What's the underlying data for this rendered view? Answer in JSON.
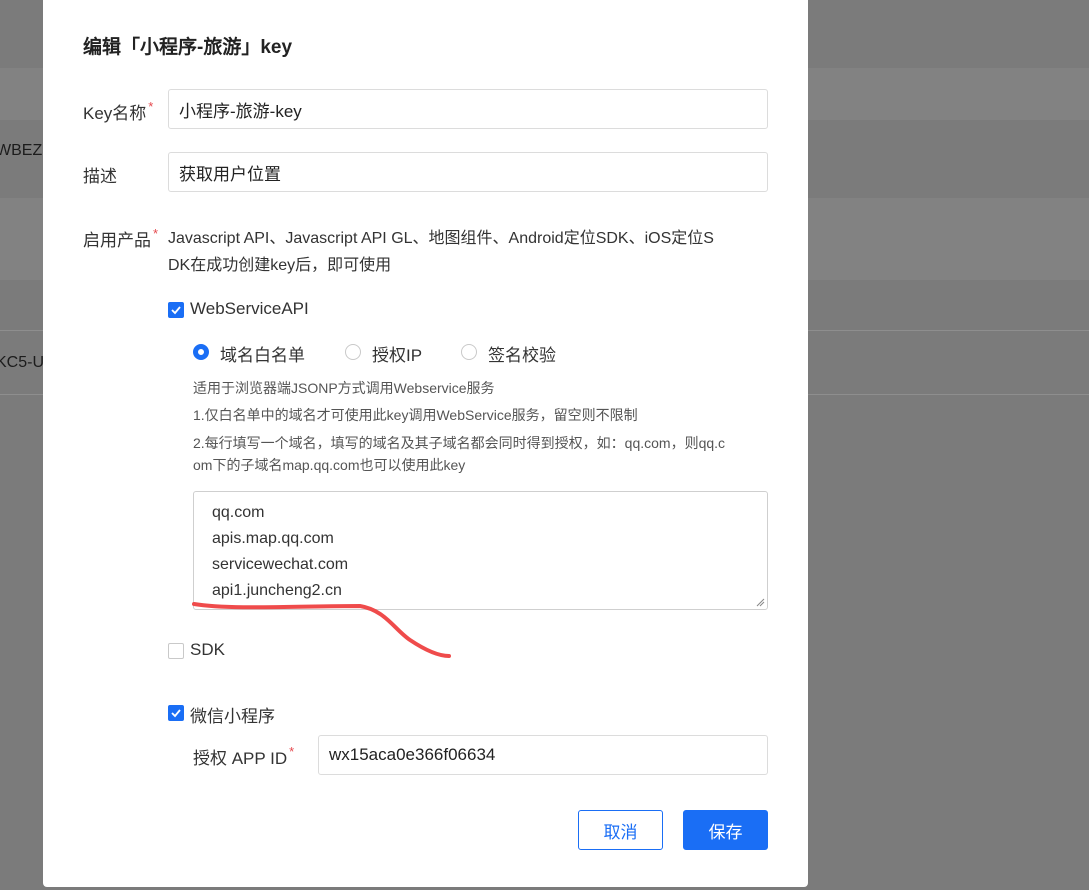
{
  "background": {
    "fragments": [
      "WBEZ",
      "KC5-U"
    ]
  },
  "dialog": {
    "title": "编辑「小程序-旅游」key",
    "key_name": {
      "label": "Key名称",
      "required": "*",
      "value": "小程序-旅游-key"
    },
    "description": {
      "label": "描述",
      "value": "获取用户位置"
    },
    "products": {
      "label": "启用产品",
      "required": "*",
      "text_line1": "Javascript API、Javascript API GL、地图组件、Android定位SDK、iOS定位S",
      "text_line2": "DK在成功创建key后，即可使用"
    },
    "webservice": {
      "label": "WebServiceAPI",
      "checked": true,
      "radios": [
        {
          "label": "域名白名单",
          "selected": true
        },
        {
          "label": "授权IP",
          "selected": false
        },
        {
          "label": "签名校验",
          "selected": false
        }
      ],
      "hints": [
        "适用于浏览器端JSONP方式调用Webservice服务",
        "1.仅白名单中的域名才可使用此key调用WebService服务，留空则不限制",
        "2.每行填写一个域名，填写的域名及其子域名都会同时得到授权，如：qq.com，则qq.c",
        "om下的子域名map.qq.com也可以使用此key"
      ],
      "domains": [
        "qq.com",
        "apis.map.qq.com",
        "servicewechat.com",
        "api1.juncheng2.cn"
      ]
    },
    "sdk": {
      "label": "SDK",
      "checked": false
    },
    "miniprogram": {
      "label": "微信小程序",
      "checked": true,
      "appid_label": "授权 APP ID",
      "required": "*",
      "appid_value": "wx15aca0e366f06634"
    },
    "buttons": {
      "cancel": "取消",
      "save": "保存"
    },
    "colors": {
      "accent": "#1a6ef5",
      "required": "#e5484d",
      "annotation": "#ef4b4b"
    }
  }
}
